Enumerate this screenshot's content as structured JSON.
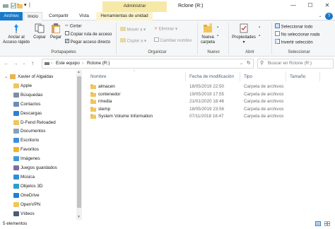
{
  "titlebar": {
    "context_tab": "Administrar",
    "title": "Rclone (R:)",
    "minimize": "—",
    "maximize": "☐",
    "close": "✕"
  },
  "ribbon_tabs": {
    "file": "Archivo",
    "home": "Inicio",
    "share": "Compartir",
    "view": "Vista",
    "manage": "Herramientas de unidad",
    "help": "?"
  },
  "ribbon": {
    "pin": [
      "Anclar al",
      "Acceso rápido"
    ],
    "copy": "Copiar",
    "paste": "Pegar",
    "cut": "Cortar",
    "copy_path": "Copiar ruta de acceso",
    "paste_shortcut": "Pegar acceso directo",
    "clipboard_group": "Portapapeles",
    "move_to": "Mover a",
    "copy_to": "Copiar a",
    "delete": "Eliminar",
    "rename": "Cambiar nombre",
    "organize_group": "Organizar",
    "new_folder": [
      "Nueva",
      "carpeta"
    ],
    "new_group": "Nuevo",
    "properties": "Propiedades",
    "open_group": "Abrir",
    "select_all": "Seleccionar todo",
    "select_none": "No seleccionar nada",
    "invert_selection": "Invertir selección",
    "select_group": "Seleccionar"
  },
  "address": {
    "path": [
      "Este equipo",
      "Rclone (R:)"
    ],
    "search_placeholder": "Buscar en Rclone (R:)"
  },
  "nav": [
    {
      "label": "Xavier of Algaidas",
      "icon": "user-folder-icon",
      "indent": 0
    },
    {
      "label": "Apple",
      "icon": "folder-icon",
      "indent": 1
    },
    {
      "label": "Búsquedas",
      "icon": "search-folder-icon",
      "indent": 1
    },
    {
      "label": "Contactos",
      "icon": "contacts-icon",
      "indent": 1
    },
    {
      "label": "Descargas",
      "icon": "downloads-icon",
      "indent": 1
    },
    {
      "label": "D-Fend Reloaded",
      "icon": "folder-icon",
      "indent": 1
    },
    {
      "label": "Documentos",
      "icon": "documents-icon",
      "indent": 1
    },
    {
      "label": "Escritorio",
      "icon": "desktop-icon",
      "indent": 1
    },
    {
      "label": "Favoritos",
      "icon": "favorites-icon",
      "indent": 1
    },
    {
      "label": "Imágenes",
      "icon": "pictures-icon",
      "indent": 1
    },
    {
      "label": "Juegos guardados",
      "icon": "saved-games-icon",
      "indent": 1
    },
    {
      "label": "Música",
      "icon": "music-icon",
      "indent": 1
    },
    {
      "label": "Objetos 3D",
      "icon": "3d-objects-icon",
      "indent": 1
    },
    {
      "label": "OneDrive",
      "icon": "onedrive-icon",
      "indent": 1
    },
    {
      "label": "OpenVPN",
      "icon": "folder-icon",
      "indent": 1
    },
    {
      "label": "Vídeos",
      "icon": "videos-icon",
      "indent": 1
    }
  ],
  "columns": {
    "name": "Nombre",
    "date": "Fecha de modificación",
    "type": "Tipo",
    "size": "Tamaño"
  },
  "files": [
    {
      "name": "almacen",
      "date": "18/05/2019 22:50",
      "type": "Carpeta de archivos",
      "size": ""
    },
    {
      "name": "contenedor",
      "date": "19/05/2019 17:55",
      "type": "Carpeta de archivos",
      "size": ""
    },
    {
      "name": "rmedia",
      "date": "21/01/2020 18:46",
      "type": "Carpeta de archivos",
      "size": ""
    },
    {
      "name": "stemp",
      "date": "18/05/2019 23:56",
      "type": "Carpeta de archivos",
      "size": ""
    },
    {
      "name": "System Volume Information",
      "date": "07/11/2018 18:47",
      "type": "Carpeta de archivos",
      "size": ""
    }
  ],
  "status": {
    "count": "5 elementos"
  },
  "colors": {
    "accent": "#1979ca",
    "folder": "#f2c55c",
    "context_tab": "#f6e9a8"
  }
}
